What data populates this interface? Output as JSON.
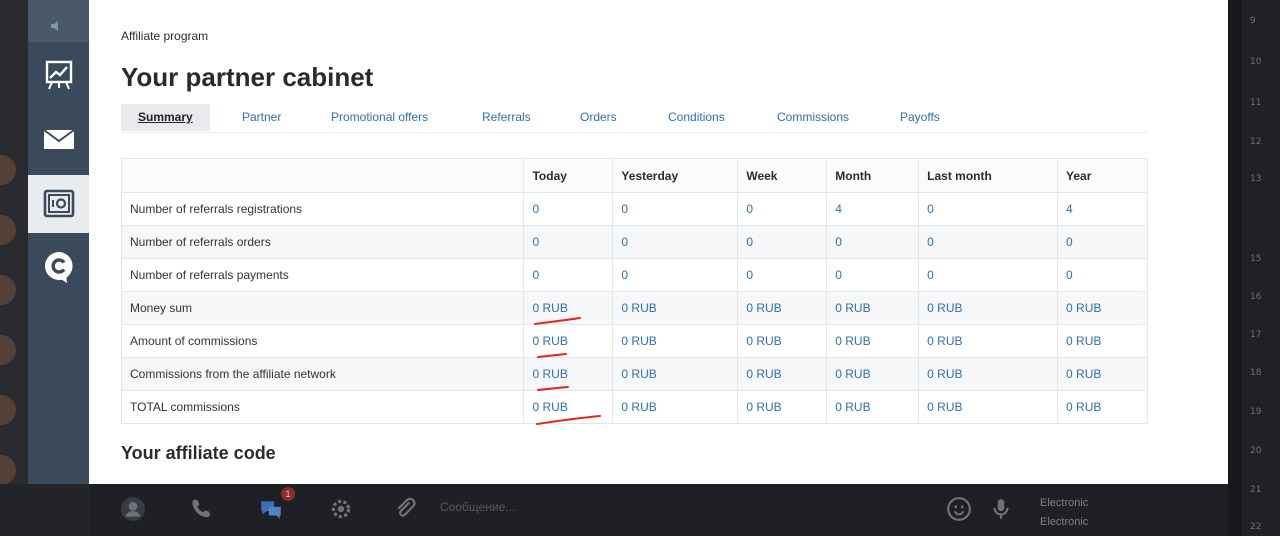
{
  "app": {
    "breadcrumb": "Affiliate program",
    "page_title": "Your partner cabinet",
    "section_title": "Your affiliate code"
  },
  "tabs": [
    {
      "label": "Summary",
      "active": true
    },
    {
      "label": "Partner"
    },
    {
      "label": "Promotional offers"
    },
    {
      "label": "Referrals"
    },
    {
      "label": "Orders"
    },
    {
      "label": "Conditions"
    },
    {
      "label": "Commissions"
    },
    {
      "label": "Payoffs"
    }
  ],
  "table": {
    "columns": [
      "Today",
      "Yesterday",
      "Week",
      "Month",
      "Last month",
      "Year"
    ],
    "rows": [
      {
        "label": "Number of referrals registrations",
        "values": [
          "0",
          "0",
          "0",
          "4",
          "0",
          "4"
        ]
      },
      {
        "label": "Number of referrals orders",
        "values": [
          "0",
          "0",
          "0",
          "0",
          "0",
          "0"
        ]
      },
      {
        "label": "Number of referrals payments",
        "values": [
          "0",
          "0",
          "0",
          "0",
          "0",
          "0"
        ]
      },
      {
        "label": "Money sum",
        "values": [
          "0 RUB",
          "0 RUB",
          "0 RUB",
          "0 RUB",
          "0 RUB",
          "0 RUB"
        ]
      },
      {
        "label": "Amount of commissions",
        "values": [
          "0 RUB",
          "0 RUB",
          "0 RUB",
          "0 RUB",
          "0 RUB",
          "0 RUB"
        ]
      },
      {
        "label": "Commissions from the affiliate network",
        "values": [
          "0 RUB",
          "0 RUB",
          "0 RUB",
          "0 RUB",
          "0 RUB",
          "0 RUB"
        ]
      },
      {
        "label": "TOTAL commissions",
        "values": [
          "0 RUB",
          "0 RUB",
          "0 RUB",
          "0 RUB",
          "0 RUB",
          "0 RUB"
        ]
      }
    ]
  },
  "sidebar": {
    "items": [
      {
        "icon": "chart-board-icon"
      },
      {
        "icon": "mail-icon"
      },
      {
        "icon": "safe-icon",
        "active": true
      },
      {
        "icon": "chat-c-icon"
      }
    ]
  },
  "chat_bar": {
    "message_placeholder": "Сообщение...",
    "badge": "1",
    "side_labels": [
      "Electronic",
      "Electronic"
    ]
  },
  "background": {
    "right_ticks": [
      "9",
      "10",
      "11",
      "12",
      "13",
      "15",
      "16",
      "17",
      "18",
      "19",
      "20",
      "21",
      "22"
    ]
  },
  "colors": {
    "link": "#2f6fb0",
    "sidebar": "#3b4a5a",
    "annotation": "#e0261f"
  }
}
